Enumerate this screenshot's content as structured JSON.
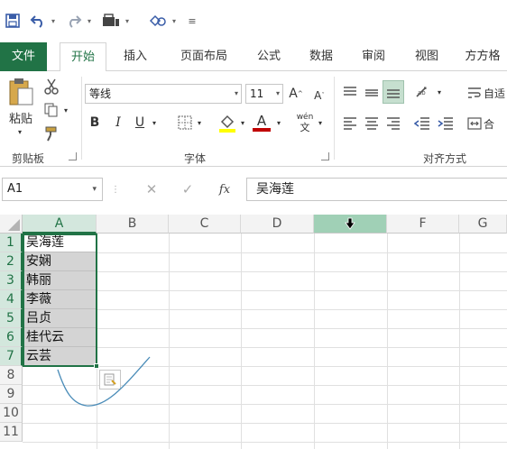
{
  "quick_access": {
    "save_icon": "save-icon",
    "undo_icon": "undo-icon",
    "redo_icon": "redo-icon",
    "touch_icon": "touch-mode-icon",
    "shapes_icon": "shapes-icon",
    "customize_icon": "customize-qat-icon"
  },
  "tabs": [
    "文件",
    "开始",
    "插入",
    "页面布局",
    "公式",
    "数据",
    "审阅",
    "视图",
    "方方格"
  ],
  "ribbon": {
    "clipboard": {
      "paste_label": "粘贴",
      "group_label": "剪贴板"
    },
    "font": {
      "font_name": "等线",
      "font_size": "11",
      "grow_font": "A",
      "shrink_font": "A",
      "bold": "B",
      "italic": "I",
      "underline": "U",
      "font_color": "A",
      "phonetic": "wén",
      "phonetic_sub": "文",
      "group_label": "字体",
      "fill_color": "#ffff00",
      "text_color": "#c00000"
    },
    "alignment": {
      "wrap_text": "自适",
      "merge": "合",
      "group_label": "对齐方式"
    }
  },
  "formula_bar": {
    "name_box": "A1",
    "fx_label": "fx",
    "content": "吴海莲"
  },
  "grid": {
    "columns": [
      "A",
      "B",
      "C",
      "D",
      "E",
      "F",
      "G"
    ],
    "rows": [
      "1",
      "2",
      "3",
      "4",
      "5",
      "6",
      "7",
      "8",
      "9",
      "10",
      "11"
    ],
    "column_a_values": [
      "吴海莲",
      "安娴",
      "韩丽",
      "李薇",
      "吕贞",
      "桂代云",
      "云芸"
    ],
    "accent": "#217346"
  }
}
